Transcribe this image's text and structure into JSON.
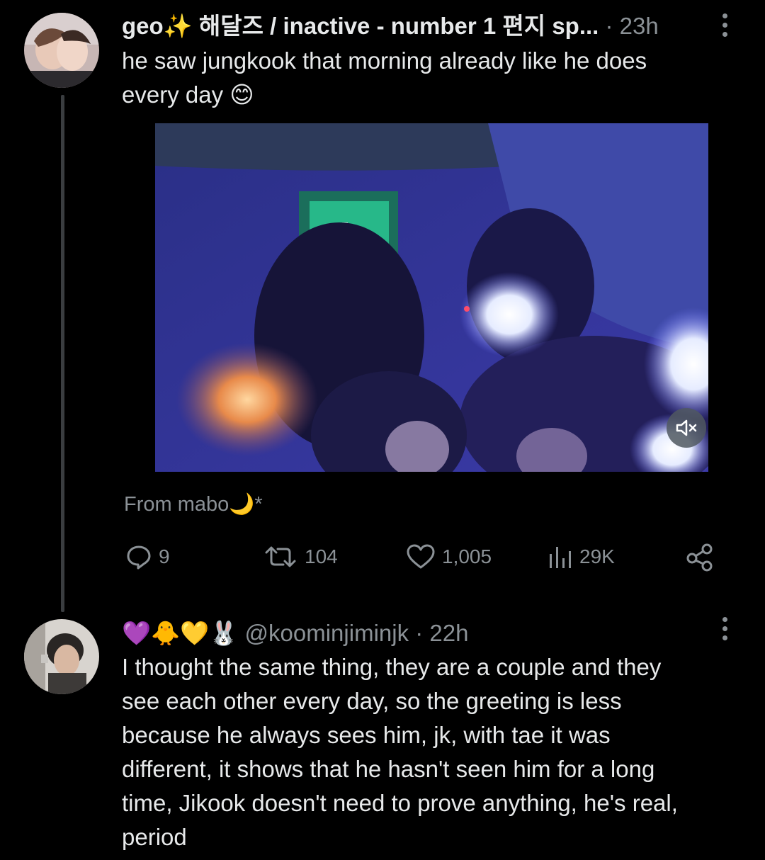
{
  "thread": [
    {
      "author": {
        "name": "geo✨ 해달즈 / inactive - number 1 편지 sp...",
        "time": "23h"
      },
      "text": [
        "he saw jungkook that morning already like he does",
        "every day 😊"
      ],
      "media": {
        "type": "video",
        "muted": true,
        "mute_icon": "speaker-muted-icon"
      },
      "source": "From mabo🌙*",
      "actions": {
        "replies": "9",
        "reposts": "104",
        "likes": "1,005",
        "views": "29K"
      }
    },
    {
      "author": {
        "emojis": "💜🐥💛🐰",
        "handle": "@koominjiminjk",
        "time": "22h"
      },
      "text": [
        "I thought the same thing, they are a couple and they",
        "see each other every day, so the greeting is less",
        "because he always sees him, jk, with tae it was",
        "different, it shows that he hasn't seen him for a long",
        "time, Jikook doesn't need to prove anything, he's real,",
        "period"
      ]
    }
  ],
  "colors": {
    "background": "#000000",
    "text_primary": "#e7e9ea",
    "text_secondary": "#8b9196",
    "thread_line": "#3a3d40"
  }
}
